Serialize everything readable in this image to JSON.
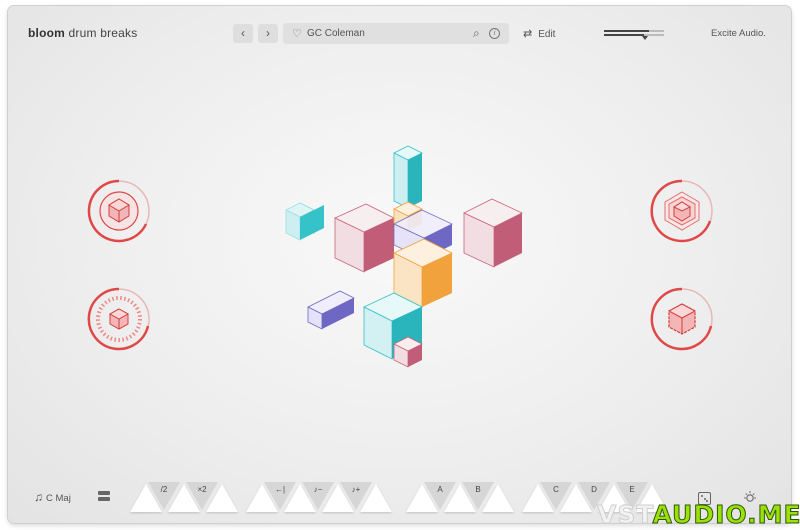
{
  "header": {
    "brand_bold": "bloom",
    "brand_rest": " drum breaks",
    "prev_label": "‹",
    "next_label": "›",
    "preset_name": "GC Coleman",
    "edit_label": "Edit",
    "maker": "Excite Audio."
  },
  "footer": {
    "key_label": "C Maj",
    "pads": [
      {
        "label": "/2"
      },
      {
        "label": "×2"
      },
      {
        "label": "←|"
      },
      {
        "label": "♪−"
      },
      {
        "label": "♪+"
      },
      {
        "label": "A"
      },
      {
        "label": "B"
      },
      {
        "label": "C"
      },
      {
        "label": "D"
      },
      {
        "label": "E"
      }
    ]
  },
  "watermark": {
    "part1": "VST",
    "part2": "AUDIO.ME"
  },
  "colors": {
    "accent": "#e04848",
    "pink": "#c9667e",
    "teal": "#35c2c8",
    "orange": "#f2a23c",
    "purple": "#6e68c4"
  },
  "icons": [
    "chevron-left-icon",
    "chevron-right-icon",
    "heart-icon",
    "search-icon",
    "info-icon",
    "swap-icon",
    "music-note-icon",
    "layout-icon",
    "dice-icon",
    "sun-icon"
  ]
}
